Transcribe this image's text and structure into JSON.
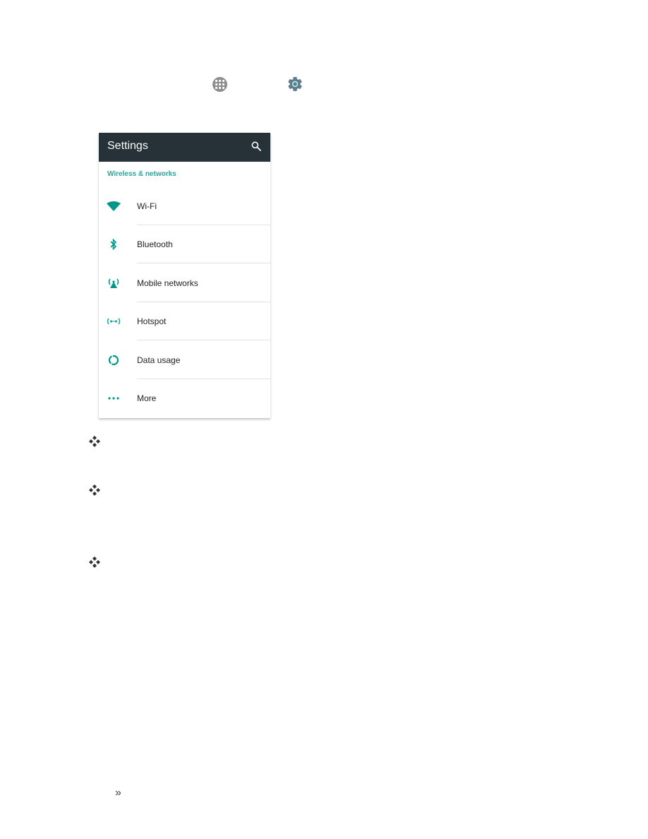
{
  "instruction_icons": {
    "apps": "apps-grid-icon",
    "settings": "gear-icon"
  },
  "screenshot": {
    "toolbar": {
      "title": "Settings",
      "search_icon": "search-icon"
    },
    "section_header": "Wireless & networks",
    "items": [
      {
        "label": "Wi-Fi",
        "icon": "wifi-icon"
      },
      {
        "label": "Bluetooth",
        "icon": "bluetooth-icon"
      },
      {
        "label": "Mobile networks",
        "icon": "mobile-networks-icon"
      },
      {
        "label": "Hotspot",
        "icon": "hotspot-icon"
      },
      {
        "label": "Data usage",
        "icon": "data-usage-icon"
      },
      {
        "label": "More",
        "icon": "more-icon"
      }
    ],
    "colors": {
      "toolbar": "#263238",
      "accent": "#26a69a",
      "icon_teal": "#009688"
    }
  },
  "bullets": [
    "diamond-bullet",
    "diamond-bullet",
    "diamond-bullet"
  ],
  "footer_glyph": "»"
}
